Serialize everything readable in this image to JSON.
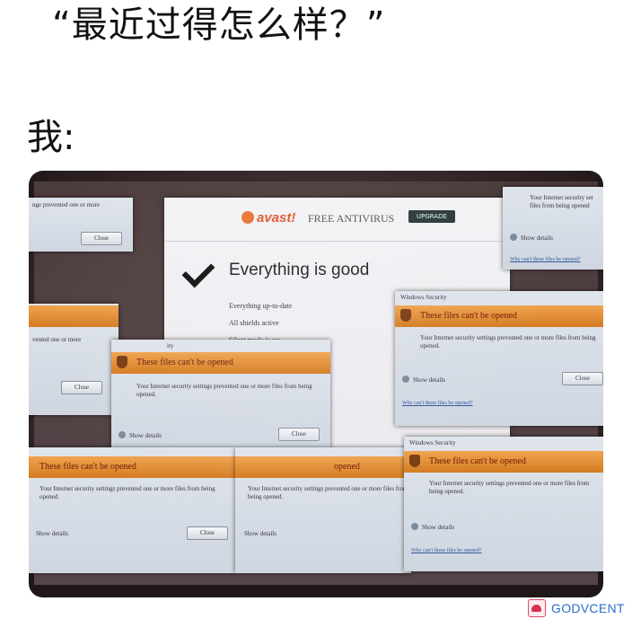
{
  "caption": {
    "question": "“最近过得怎么样？”",
    "answer": "我:"
  },
  "avast": {
    "logo": "avast!",
    "product": "FREE ANTIVIRUS",
    "upgrade": "UPGRADE",
    "status": "Everything is good",
    "lines": [
      "Everything up-to-date",
      "All shields active",
      "Silent mode is on:"
    ]
  },
  "dialog": {
    "title": "Windows Security",
    "heading": "These files can't be opened",
    "message": "Your Internet security settings prevented one or more files from being opened.",
    "details": "Show details",
    "close": "Close",
    "link": "Why can't these files be opened?"
  },
  "partial": {
    "title_fragment": "ity",
    "heading_fragment": "opened",
    "message_fragment": "nge prevented one or more",
    "message_fragment_2": "vented one or more",
    "short_title": "Your Internet security set files from being opened"
  },
  "watermark": {
    "text": "GODVCENT"
  },
  "colors": {
    "banner": "#d47b21",
    "brand": "#e2572a",
    "watermark": "#2a6fc9"
  }
}
